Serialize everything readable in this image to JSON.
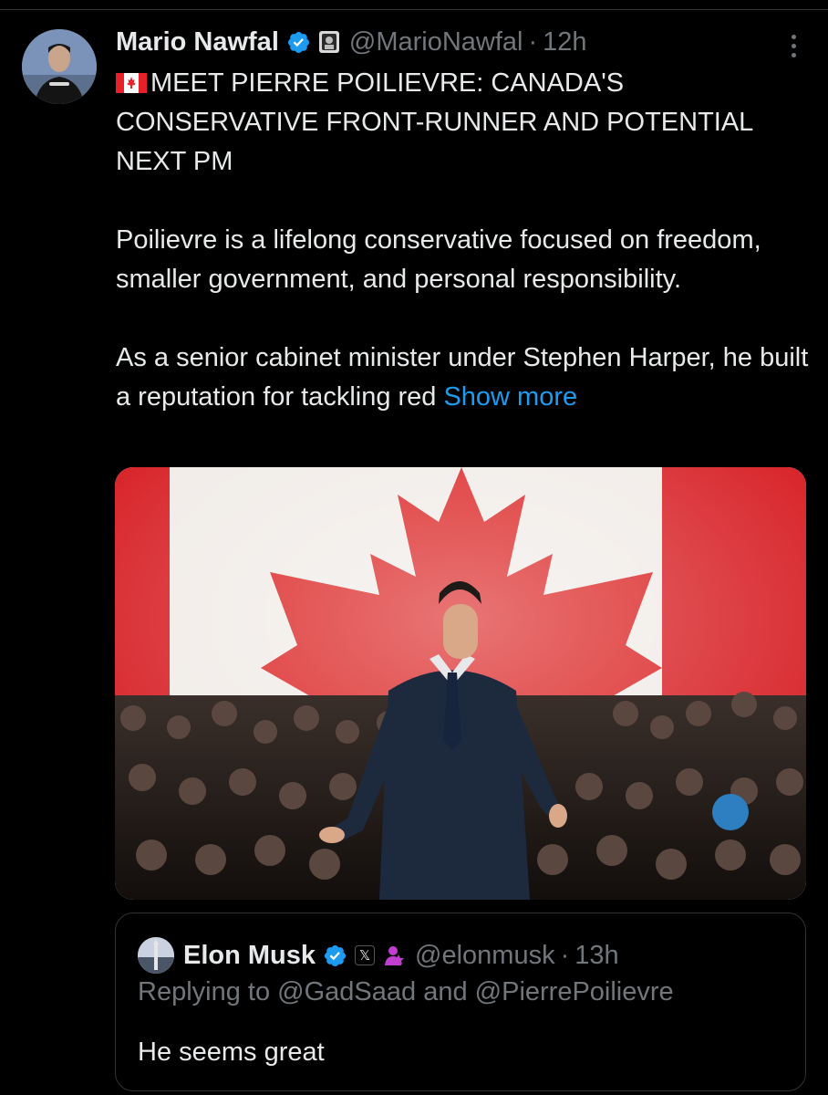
{
  "tweet": {
    "author_name": "Mario Nawfal",
    "author_handle": "@MarioNawfal",
    "separator": "·",
    "time": "12h",
    "headline": "MEET PIERRE POILIEVRE: CANADA'S CONSERVATIVE FRONT-RUNNER AND POTENTIAL NEXT PM",
    "paragraph_1": "Poilievre is a lifelong conservative focused on freedom, smaller government, and personal responsibility.",
    "paragraph_2": "As a senior cabinet minister under Stephen Harper, he built a reputation for tackling red",
    "show_more": "Show more",
    "icons": {
      "verified": "verified-badge-icon",
      "affiliate": "affiliate-badge-icon",
      "more": "more-options-icon",
      "flag": "canada-flag-emoji"
    }
  },
  "media": {
    "description_icon": "photo"
  },
  "quote": {
    "author_name": "Elon Musk",
    "author_handle": "@elonmusk",
    "separator": "·",
    "time": "13h",
    "x_badge": "𝕏",
    "replying_prefix": "Replying to",
    "reply_to_1": "@GadSaad",
    "reply_and": "and",
    "reply_to_2": "@PierrePoilievre",
    "text": "He seems great"
  },
  "colors": {
    "background": "#000000",
    "text": "#e7e9ea",
    "muted": "#71767b",
    "link": "#1d9bf0",
    "border": "#2f3336",
    "verified": "#1d9bf0",
    "flag_red": "#e8202a"
  }
}
